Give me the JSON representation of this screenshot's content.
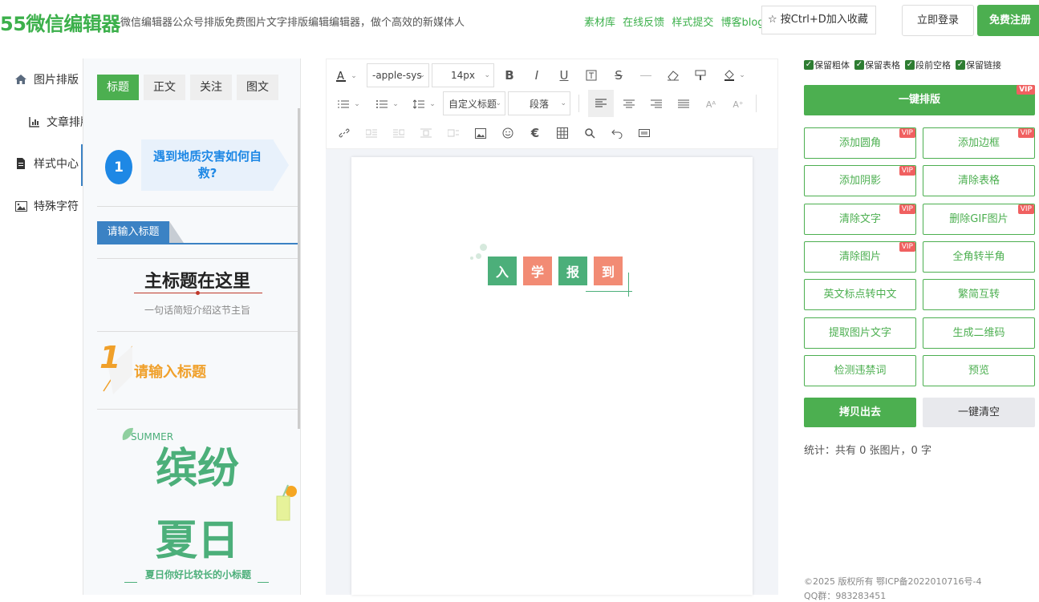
{
  "header": {
    "logo": "55微信编辑器",
    "tagline": "微信编辑器公众号排版免费图片文字排版编辑编辑器，做个高效的新媒体人",
    "links": [
      "素材库",
      "在线反馈",
      "样式提交",
      "博客blog"
    ],
    "favorite": "☆ 按Ctrl+D加入收藏",
    "login": "立即登录",
    "register": "免费注册"
  },
  "nav": {
    "items": [
      "图片排版",
      "文章排版",
      "样式中心",
      "特殊字符"
    ]
  },
  "style_panel": {
    "tabs": [
      "标题",
      "正文",
      "关注",
      "图文"
    ],
    "items": {
      "s1_number": "1",
      "s1_text": "遇到地质灾害如何自救?",
      "s2_label": "请输入标题",
      "s3_title": "主标题在这里",
      "s3_sub": "一句话简短介绍这节主旨",
      "s4_number": "1",
      "s4_text": "请输入标题",
      "s5_summer": "SUMMER",
      "s5_line1": "缤纷",
      "s5_line2": "夏日",
      "s5_caption": "夏日你好比较长的小标题"
    }
  },
  "toolbar": {
    "font_family": "-apple-sys",
    "font_size": "14px",
    "heading_style": "自定义标题",
    "paragraph": "段落"
  },
  "editor": {
    "chars": [
      "入",
      "学",
      "报",
      "到"
    ]
  },
  "right": {
    "keep": [
      "保留粗体",
      "保留表格",
      "段前空格",
      "保留链接"
    ],
    "onekey": "一键排版",
    "vip": "VIP",
    "ops": [
      {
        "label": "添加圆角",
        "vip": true
      },
      {
        "label": "添加边框",
        "vip": true
      },
      {
        "label": "添加阴影",
        "vip": true
      },
      {
        "label": "清除表格",
        "vip": false
      },
      {
        "label": "清除文字",
        "vip": true
      },
      {
        "label": "删除GIF图片",
        "vip": true
      },
      {
        "label": "清除图片",
        "vip": true
      },
      {
        "label": "全角转半角",
        "vip": false
      },
      {
        "label": "英文标点转中文",
        "vip": false
      },
      {
        "label": "繁简互转",
        "vip": false
      },
      {
        "label": "提取图片文字",
        "vip": false
      },
      {
        "label": "生成二维码",
        "vip": false
      },
      {
        "label": "检测违禁词",
        "vip": false
      },
      {
        "label": "预览",
        "vip": false
      }
    ],
    "copy": "拷贝出去",
    "clear": "一键清空",
    "stats": "统计：共有 0 张图片，0 字",
    "copyright": "©2025 版权所有 鄂ICP备2022010716号-4",
    "qq": "QQ群：983283451"
  },
  "colors": {
    "accent": "#4caf50",
    "salmon": "#f28b74",
    "teal": "#4caf7a",
    "orange": "#f0a02a",
    "blue": "#1e88e5"
  }
}
